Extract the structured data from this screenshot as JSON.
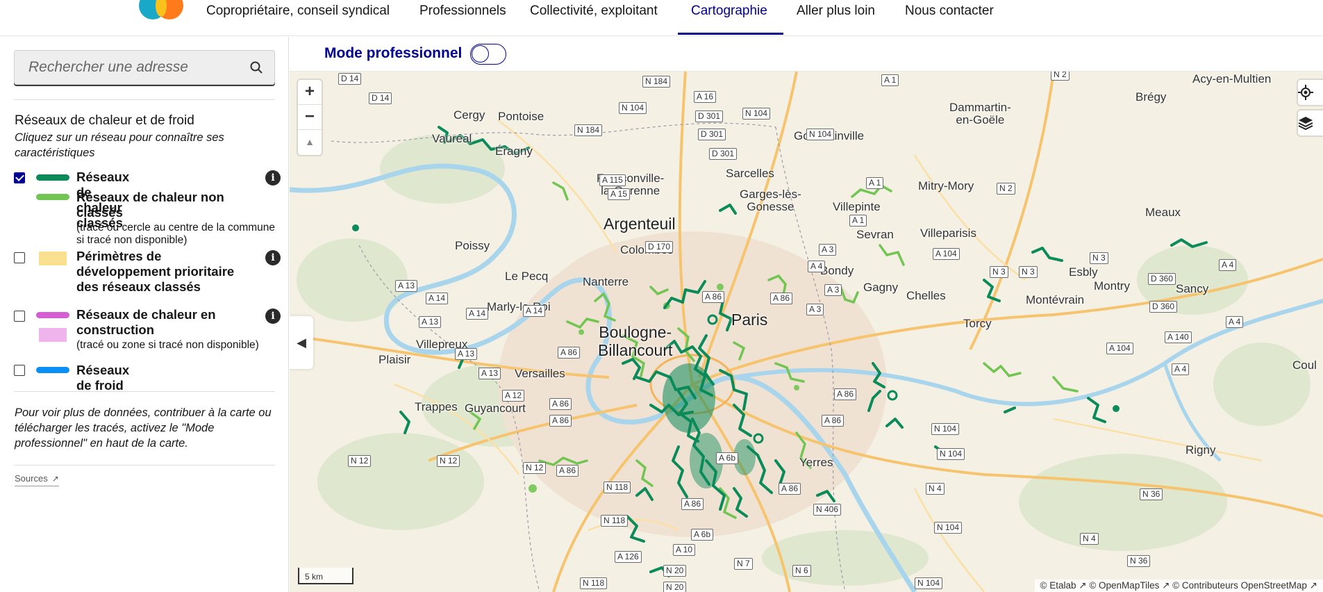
{
  "nav": {
    "items": [
      {
        "label": "Copropriétaire, conseil syndical",
        "active": false
      },
      {
        "label": "Professionnels",
        "active": false
      },
      {
        "label": "Collectivité, exploitant",
        "active": false
      },
      {
        "label": "Cartographie",
        "active": true
      },
      {
        "label": "Aller plus loin",
        "active": false
      },
      {
        "label": "Nous contacter",
        "active": false
      }
    ],
    "active_color": "#000091"
  },
  "search": {
    "placeholder": "Rechercher une adresse",
    "icon": "search-icon"
  },
  "legend": {
    "title": "Réseaux de chaleur et de froid",
    "subtitle": "Cliquez sur un réseau pour connaître ses caractéristiques",
    "layers": [
      {
        "label": "Réseaux de chaleur classés",
        "checked": true,
        "color": "#0b8a5a",
        "info": true
      },
      {
        "label": "Réseaux de chaleur non classés",
        "note": "(tracé ou cercle au centre de la commune si tracé non disponible)",
        "color": "#72c552"
      },
      {
        "label": "Périmètres de développement prioritaire des réseaux classés",
        "checked": false,
        "color": "#f8e08e",
        "info": true
      },
      {
        "label": "Réseaux de chaleur en construction",
        "note": "(tracé ou zone si tracé non disponible)",
        "checked": false,
        "color": "#d55ed4",
        "color_zone": "#f0b4ec",
        "info": true
      },
      {
        "label": "Réseaux de froid",
        "checked": false,
        "color": "#0a8ff5"
      }
    ],
    "info_glyph": "i"
  },
  "pro_hint": "Pour voir plus de données, contribuer à la carte ou télécharger les tracés, activez le \"Mode professionnel\" en haut de la carte.",
  "sources_label": "Sources",
  "mode": {
    "label": "Mode professionnel",
    "enabled": false
  },
  "map": {
    "zoom_in": "+",
    "zoom_out": "−",
    "compass": "▲",
    "collapse_glyph": "◀",
    "scale_label": "5 km",
    "attribution": "© Etalab ↗ © OpenMapTiles ↗ © Contributeurs OpenStreetMap ↗",
    "places": [
      {
        "name": "Acy-en-Multien",
        "big": false
      },
      {
        "name": "Brégy",
        "big": false
      },
      {
        "name": "Dammartin-\nen-Goële",
        "big": false
      },
      {
        "name": "Cergy",
        "big": false
      },
      {
        "name": "Pontoise",
        "big": false
      },
      {
        "name": "Vauréal",
        "big": false
      },
      {
        "name": "Éragny",
        "big": false
      },
      {
        "name": "Goussainville",
        "big": false
      },
      {
        "name": "Sarcelles",
        "big": false
      },
      {
        "name": "Franconville-\nla-Garenne",
        "big": false
      },
      {
        "name": "Garges-lès-\nGonesse",
        "big": false
      },
      {
        "name": "Mitry-Mory",
        "big": false
      },
      {
        "name": "Villepinte",
        "big": false
      },
      {
        "name": "Argenteuil",
        "big": true
      },
      {
        "name": "Sevran",
        "big": false
      },
      {
        "name": "Villeparisis",
        "big": false
      },
      {
        "name": "Meaux",
        "big": false
      },
      {
        "name": "Poissy",
        "big": false
      },
      {
        "name": "Colombes",
        "big": false
      },
      {
        "name": "Bondy",
        "big": false
      },
      {
        "name": "Le Pecq",
        "big": false
      },
      {
        "name": "Nanterre",
        "big": false
      },
      {
        "name": "Esbly",
        "big": false
      },
      {
        "name": "Gagny",
        "big": false
      },
      {
        "name": "Montry",
        "big": false
      },
      {
        "name": "Sancy",
        "big": false
      },
      {
        "name": "Chelles",
        "big": false
      },
      {
        "name": "Montévrain",
        "big": false
      },
      {
        "name": "Marly-le-Roi",
        "big": false
      },
      {
        "name": "Paris",
        "big": true
      },
      {
        "name": "Torcy",
        "big": false
      },
      {
        "name": "Boulogne-\nBillancourt",
        "big": true
      },
      {
        "name": "Villepreux",
        "big": false
      },
      {
        "name": "Plaisir",
        "big": false
      },
      {
        "name": "Versailles",
        "big": false
      },
      {
        "name": "Coul",
        "big": false
      },
      {
        "name": "Trappes",
        "big": false
      },
      {
        "name": "Guyancourt",
        "big": false
      },
      {
        "name": "Yerres",
        "big": false
      },
      {
        "name": "Rigny",
        "big": false
      }
    ],
    "roads": [
      "D 14",
      "N 184",
      "A 1",
      "N 2",
      "D 14",
      "A 16",
      "N 104",
      "D 301",
      "N 104",
      "N 104",
      "N 184",
      "D 301",
      "D 301",
      "A 115",
      "A 15",
      "A 1",
      "N 2",
      "A 1",
      "D 170",
      "A 3",
      "A 104",
      "N 3",
      "N 3",
      "N 3",
      "A 4",
      "D 360",
      "A 4",
      "A 13",
      "A 14",
      "A 14",
      "A 86",
      "A 86",
      "A 3",
      "A 14",
      "D 360",
      "A 4",
      "A 140",
      "A 13",
      "A 3",
      "A 13",
      "A 86",
      "A 104",
      "A 4",
      "A 13",
      "A 12",
      "A 86",
      "A 86",
      "N 104",
      "A 86",
      "A 86",
      "N 12",
      "N 12",
      "N 12",
      "A 6b",
      "N 104",
      "A 86",
      "N 118",
      "A 86",
      "N 4",
      "N 36",
      "N 118",
      "A 86",
      "N 406",
      "N 104",
      "A 6b",
      "N 4",
      "A 126",
      "A 10",
      "N 7",
      "N 36",
      "N 20",
      "N 6",
      "N 118",
      "N 20",
      "N 104"
    ]
  }
}
